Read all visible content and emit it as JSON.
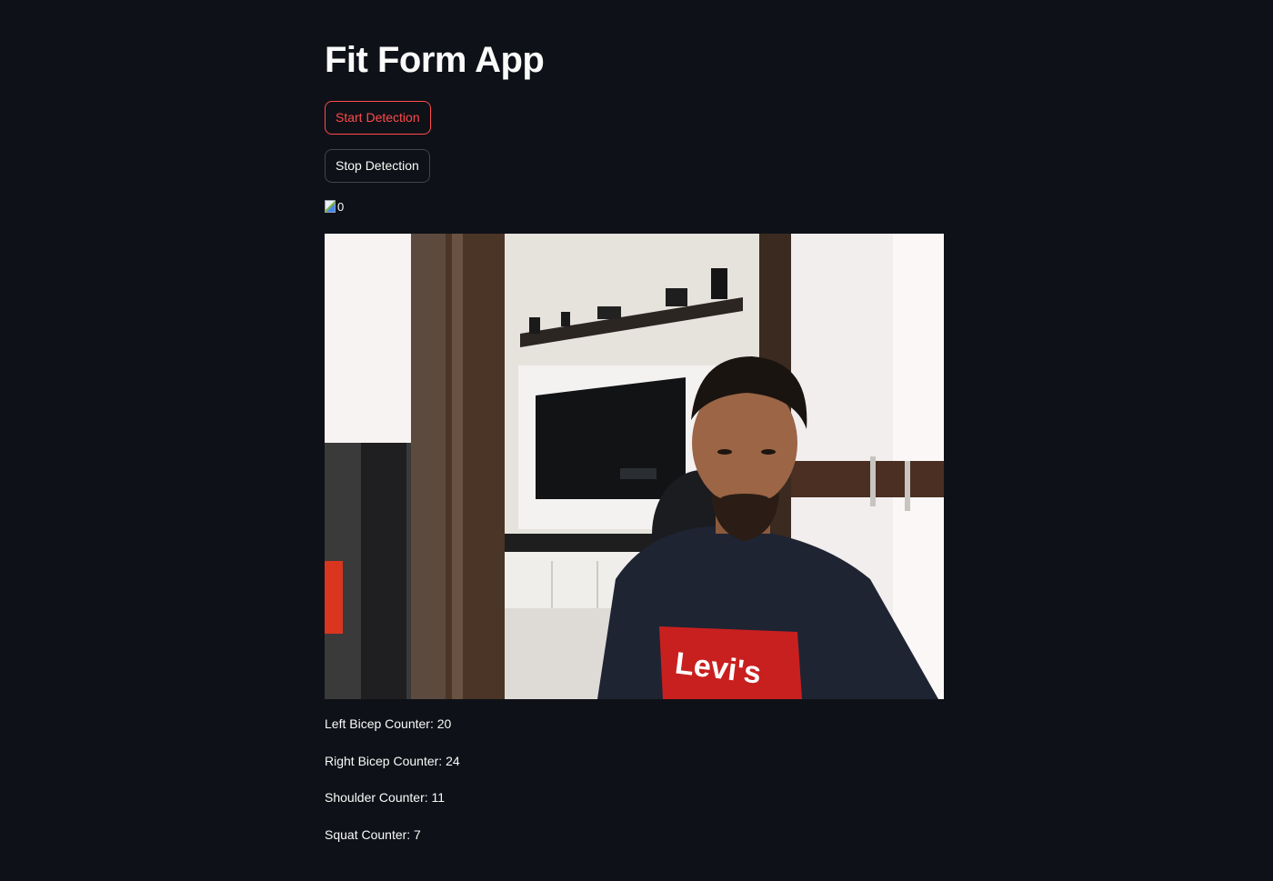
{
  "app": {
    "title": "Fit Form App"
  },
  "buttons": {
    "start_label": "Start Detection",
    "stop_label": "Stop Detection"
  },
  "broken_image": {
    "alt": "0"
  },
  "video_frame": {
    "shirt_logo": "Levi's"
  },
  "counters": {
    "left_bicep": "Left Bicep Counter: 20",
    "right_bicep": "Right Bicep Counter: 24",
    "shoulder": "Shoulder Counter: 11",
    "squat": "Squat Counter: 7"
  },
  "colors": {
    "background": "#0e1117",
    "accent": "#ff4b4b",
    "text": "#fafafa"
  }
}
